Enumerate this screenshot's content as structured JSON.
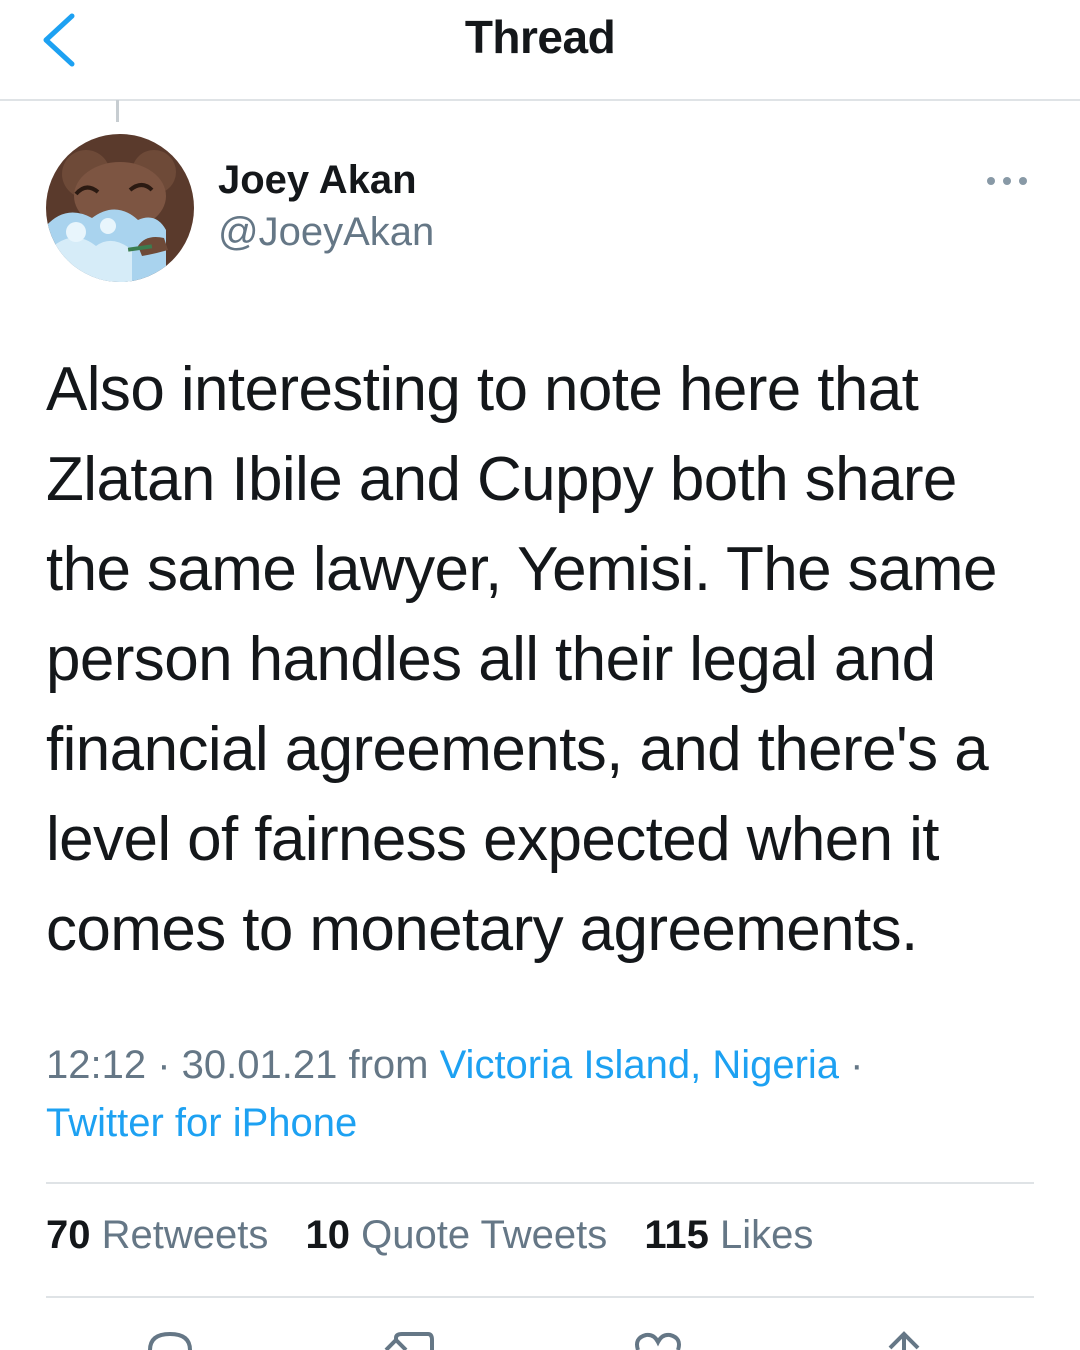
{
  "header": {
    "title": "Thread",
    "back_icon": "chevron-left-icon"
  },
  "tweet": {
    "author_name": "Joey Akan",
    "author_handle": "@JoeyAkan",
    "text": "Also interesting to note here that\nZlatan Ibile and Cuppy both share\nthe same lawyer, Yemisi. The same\nperson handles all their legal and\nfinancial agreements, and there's a\nlevel of fairness expected when it\ncomes to monetary agreements.",
    "time": "12:12",
    "sep1": " · ",
    "date": "30.01.21",
    "from_label": " from ",
    "location": "Victoria Island, Nigeria",
    "sep2": " ·",
    "source": "Twitter for iPhone"
  },
  "stats": {
    "retweets_count": "70",
    "retweets_label": "Retweets",
    "quotes_count": "10",
    "quotes_label": "Quote Tweets",
    "likes_count": "115",
    "likes_label": "Likes"
  },
  "actions": [
    "reply-icon",
    "retweet-icon",
    "like-icon",
    "share-icon"
  ],
  "colors": {
    "link": "#1da1f2",
    "muted": "#657786",
    "text": "#14171a",
    "divider": "#dfe3e6"
  }
}
